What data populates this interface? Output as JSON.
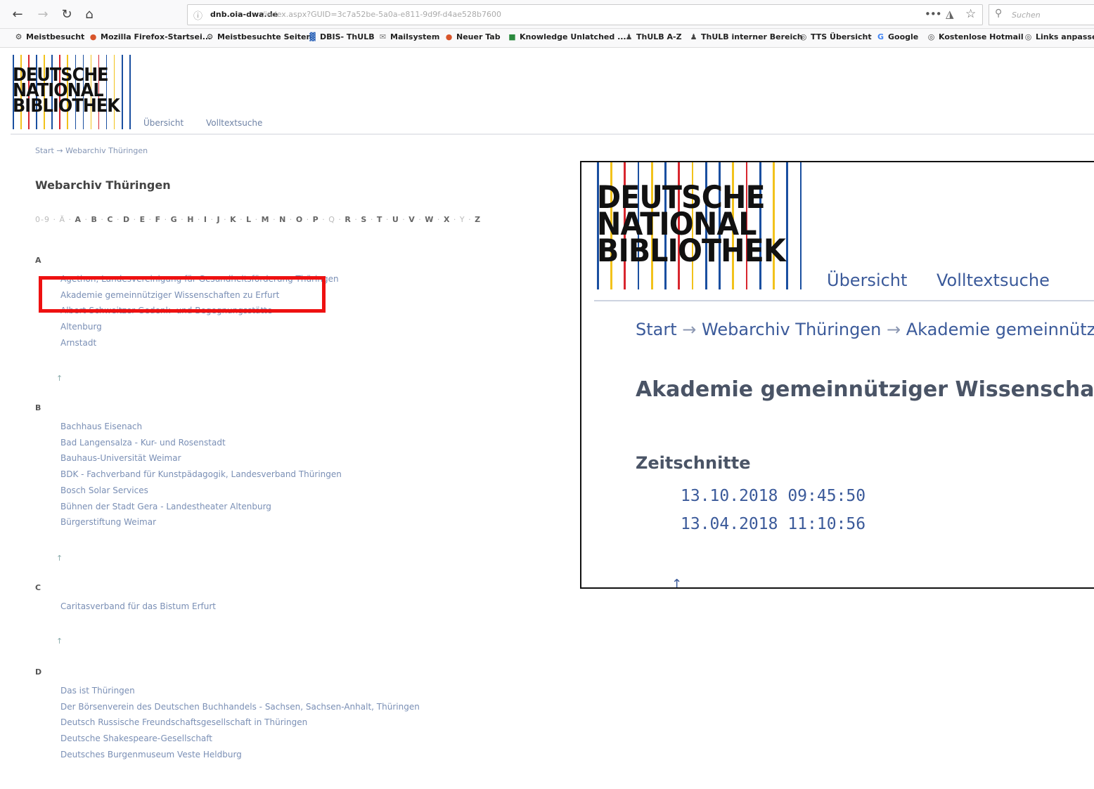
{
  "browser": {
    "url_host": "dnb.oia-dwa.de",
    "url_path": "/index.aspx?GUID=3c7a52be-5a0a-e811-9d9f-d4ae528b7600",
    "search_placeholder": "Suchen",
    "bookmarks": [
      {
        "label": "Meistbesucht",
        "icon": "gear-icon"
      },
      {
        "label": "Mozilla Firefox-Startsei...",
        "icon": "firefox-icon"
      },
      {
        "label": "Meistbesuchte Seiten",
        "icon": "gear-icon"
      },
      {
        "label": "DBIS- ThULB",
        "icon": "grid-icon"
      },
      {
        "label": "Mailsystem",
        "icon": "mail-icon"
      },
      {
        "label": "Neuer Tab",
        "icon": "firefox-icon"
      },
      {
        "label": "Knowledge Unlatched ...",
        "icon": "book-icon"
      },
      {
        "label": "ThULB A-Z",
        "icon": "person-icon"
      },
      {
        "label": "ThULB interner Bereich",
        "icon": "person-icon"
      },
      {
        "label": "TTS Übersicht",
        "icon": "globe-icon"
      },
      {
        "label": "Google",
        "icon": "google-icon"
      },
      {
        "label": "Kostenlose Hotmail",
        "icon": "globe-icon"
      },
      {
        "label": "Links anpassen",
        "icon": "globe-icon"
      }
    ]
  },
  "logo": {
    "line1": "DEUTSCHE",
    "line2": "NATIONAL",
    "line3": "BIBLIOTHEK"
  },
  "site_nav": {
    "overview": "Übersicht",
    "fulltext": "Volltextsuche"
  },
  "left": {
    "breadcrumb": "Start → Webarchiv Thüringen",
    "title": "Webarchiv Thüringen",
    "alphabet": [
      "0-9",
      "Ä",
      "A",
      "B",
      "C",
      "D",
      "E",
      "F",
      "G",
      "H",
      "I",
      "J",
      "K",
      "L",
      "M",
      "N",
      "O",
      "P",
      "Q",
      "R",
      "S",
      "T",
      "U",
      "V",
      "W",
      "X",
      "Y",
      "Z"
    ],
    "up_arrow": "↑",
    "sections": [
      {
        "letter": "A",
        "entries": [
          "Agethon, Landesvereinigung für Gesundheitsförderung Thüringen",
          "Akademie gemeinnütziger Wissenschaften zu Erfurt",
          "Albert-Schweitzer-Gedenk- und Begegnungsstätte",
          "Altenburg",
          "Arnstadt"
        ]
      },
      {
        "letter": "B",
        "entries": [
          "Bachhaus Eisenach",
          "Bad Langensalza - Kur- und Rosenstadt",
          "Bauhaus-Universität Weimar",
          "BDK - Fachverband für Kunstpädagogik, Landesverband Thüringen",
          "Bosch Solar Services",
          "Bühnen der Stadt Gera - Landestheater Altenburg",
          "Bürgerstiftung Weimar"
        ]
      },
      {
        "letter": "C",
        "entries": [
          "Caritasverband für das Bistum Erfurt"
        ]
      },
      {
        "letter": "D",
        "entries": [
          "Das ist Thüringen",
          "Der Börsenverein des Deutschen Buchhandels - Sachsen, Sachsen-Anhalt, Thüringen",
          "Deutsch Russische Freundschaftsgesellschaft in Thüringen",
          "Deutsche Shakespeare-Gesellschaft",
          "Deutsches Burgenmuseum Veste Heldburg"
        ]
      }
    ]
  },
  "zoom": {
    "bc_start": "Start",
    "bc_archive": "Webarchiv Thüringen",
    "bc_current": "Akademie gemeinnützi",
    "arrow": "→",
    "title": "Akademie gemeinnütziger Wissenschaft",
    "subtitle": "Zeitschnitte",
    "dates": [
      "13.10.2018 09:45:50",
      "13.04.2018 11:10:56"
    ],
    "up_arrow": "↑"
  },
  "colors": {
    "link": "#3b5a9a",
    "highlight": "#ee1111",
    "logo_lines": [
      "#1a4fa0",
      "#f2c21b",
      "#d8262e",
      "#1a4fa0",
      "#f2c21b",
      "#1a4fa0",
      "#d8262e",
      "#f2c21b",
      "#1a4fa0",
      "#1a4fa0",
      "#f2c21b",
      "#d8262e",
      "#1a4fa0",
      "#f2c21b",
      "#1a4fa0",
      "#1a4fa0"
    ]
  }
}
